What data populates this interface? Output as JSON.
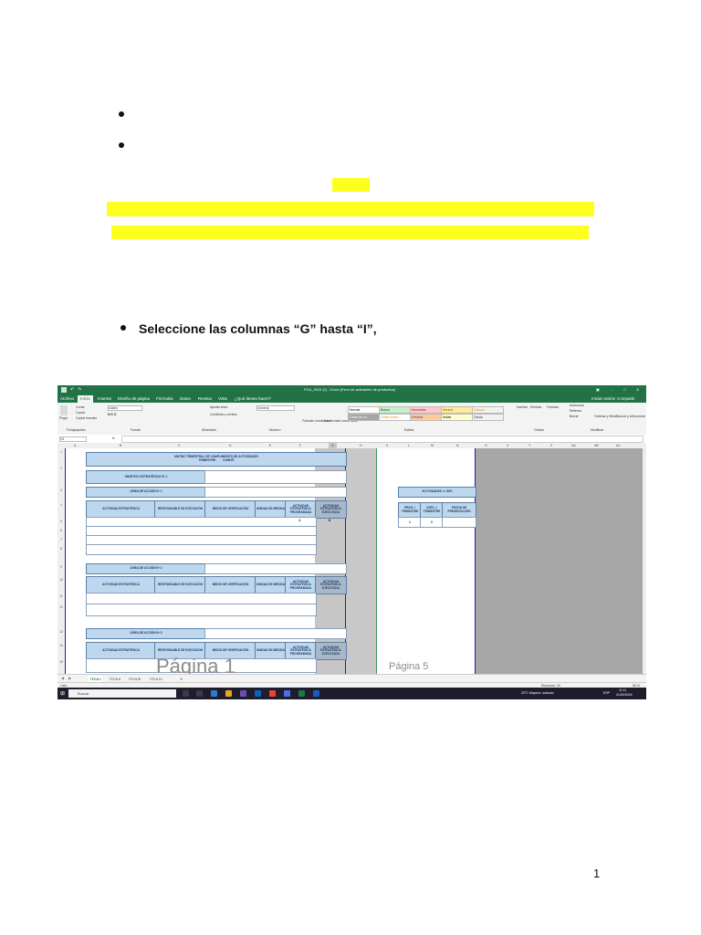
{
  "document": {
    "instruction": "Seleccione las columnas “G” hasta “I”,",
    "page_number": "1"
  },
  "excel": {
    "title": "PCA_2024 (1) - Excel (Error de activación de productos)",
    "ribbon_tabs": [
      "Archivo",
      "Inicio",
      "Insertar",
      "Diseño de página",
      "Fórmulas",
      "Datos",
      "Revisar",
      "Vista",
      "¿Qué desea hacer?"
    ],
    "user": "Iniciar sesión",
    "share": "Compartir",
    "ribbon": {
      "cortar": "Cortar",
      "copiar": "Copiar",
      "copiar_formato": "Copiar formato",
      "pegar": "Pegar",
      "font_name": "Calibri",
      "ajustar_texto": "Ajustar texto",
      "combinar": "Combinar y centrar",
      "number_format": "General",
      "formato_condicional": "Formato condicional",
      "dar_formato": "Dar formato como tabla",
      "styles": [
        "Normal",
        "Bueno",
        "Incorrecto",
        "Neutral",
        "Cálculo",
        "Celda de co...",
        "Celda vincul...",
        "Entrada",
        "Notas",
        "Salida"
      ],
      "insertar": "Insertar",
      "eliminar": "Eliminar",
      "formato": "Formato",
      "autosuma": "Autosuma",
      "rellenar": "Rellenar",
      "borrar": "Borrar",
      "ordenar": "Ordenar y filtrar",
      "buscar": "Buscar y seleccionar",
      "groups": [
        "Portapapeles",
        "Fuente",
        "Alineación",
        "Número",
        "Estilos",
        "Celdas",
        "Modificar"
      ]
    },
    "name_box": "G1",
    "columns": [
      "A",
      "B",
      "C",
      "D",
      "E",
      "F",
      "G",
      "H",
      "K",
      "L",
      "M",
      "N",
      "O",
      "X",
      "Y",
      "Z",
      "AA",
      "AB",
      "AC"
    ],
    "matrix_title": "MATRIZ TRIMESTRAL DE CUMPLIMIENTO DE ACTIVIDADES",
    "trimestre": "TRIMESTRE:",
    "comite": "COMITÉ",
    "objetivo": "OBJETIVO ESTRATÉGICO Nº 1",
    "lineas": [
      "LÍNEA DE ACCIÓN Nº 1",
      "LÍNEA DE ACCIÓN Nº 2",
      "LÍNEA DE ACCIÓN Nº 3"
    ],
    "table_headers": [
      "ACTIVIDAD ESTRATÉGICA",
      "RESPONSABLE DE EJECUCIÓN",
      "MEDIO DE VERIFICACIÓN",
      "UNIDAD DE MEDIDA",
      "ACTIVIDAD ESTRATÉGICA PROGRAMADA",
      "ACTIVIDAD ESTRATÉGICA EJECUTADA"
    ],
    "row1_values": [
      "1",
      "0"
    ],
    "side_title": "ACTIVIDADES >= 50%",
    "side_headers": [
      "PROG. I TRIMESTRE",
      "EJEC. I TRIMESTRE",
      "FECHA DE PRESENTACIÓN"
    ],
    "side_values": [
      "1",
      "0"
    ],
    "watermark_left": "Página 1",
    "watermark_right": "Página 5",
    "sheet_tabs": [
      "ITCA I",
      "ITCA II",
      "ITCA III",
      "ITCA IV"
    ],
    "status_left": "Listo",
    "status_right": "Recuento: 15",
    "zoom": "55 %",
    "taskbar": {
      "search": "Buscar",
      "weather": "20°C Mayorm. soleado",
      "lang": "ESP",
      "time": "11:11",
      "date": "01/03/2024"
    }
  },
  "colors": {
    "highlight": "#ffff1e",
    "excel_green": "#217346",
    "header_blue": "#bdd7ee"
  }
}
